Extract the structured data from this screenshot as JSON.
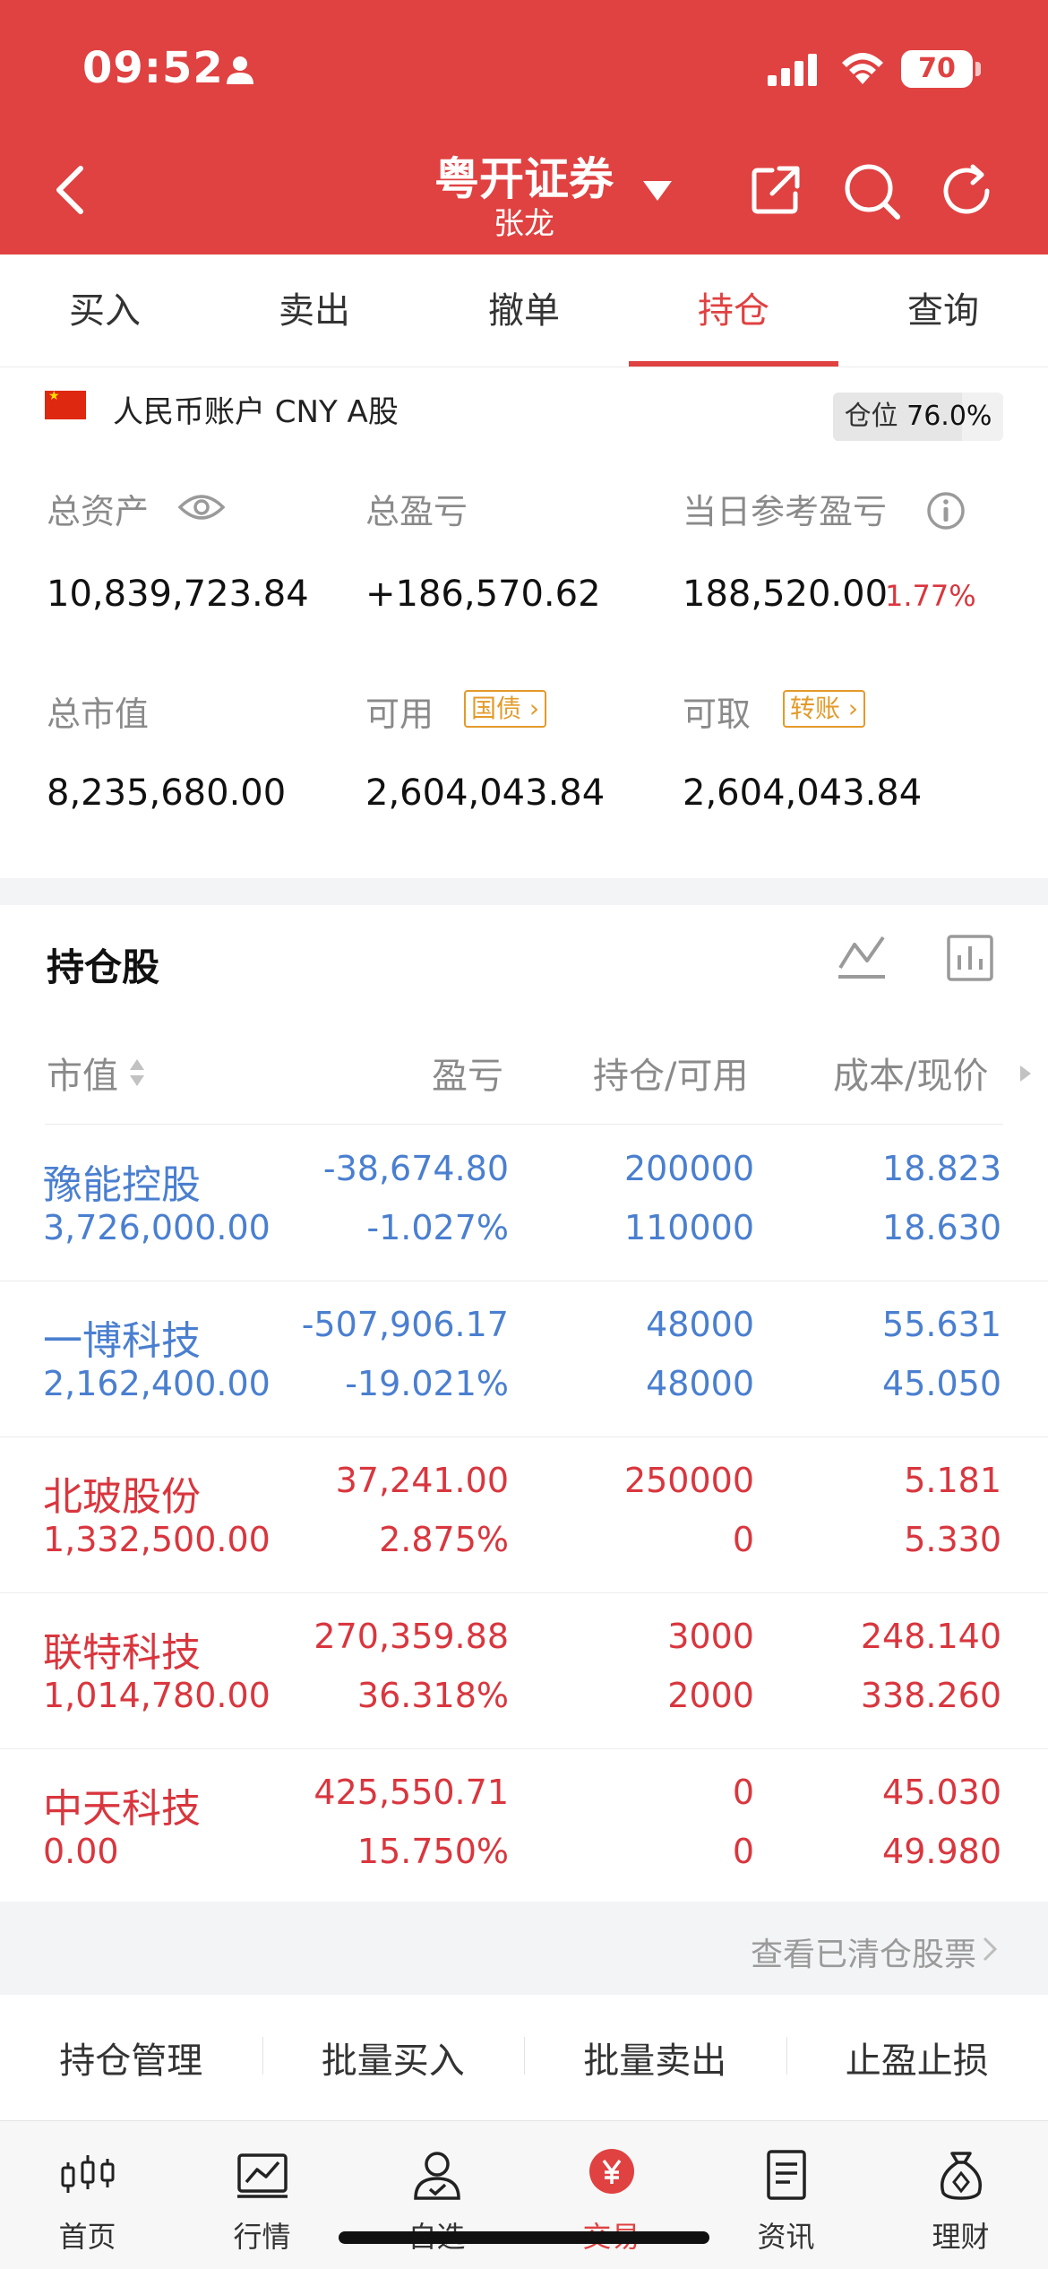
{
  "status_bar": {
    "time": "09:52",
    "battery": "70"
  },
  "header": {
    "title": "粤开证券",
    "user": "张龙"
  },
  "tabs": [
    {
      "label": "买入",
      "active": false
    },
    {
      "label": "卖出",
      "active": false
    },
    {
      "label": "撤单",
      "active": false
    },
    {
      "label": "持仓",
      "active": true
    },
    {
      "label": "查询",
      "active": false
    }
  ],
  "account": {
    "label": "人民币账户 CNY A股",
    "position_label": "仓位",
    "position_value": "76.0%",
    "position_fraction": 0.76,
    "total_assets_label": "总资产",
    "total_assets": "10,839,723.84",
    "total_pnl_label": "总盈亏",
    "total_pnl": "+186,570.62",
    "daily_pnl_label": "当日参考盈亏",
    "daily_pnl": "188,520.00",
    "daily_pnl_pct": "1.77%",
    "market_value_label": "总市值",
    "market_value": "8,235,680.00",
    "available_label": "可用",
    "available_tag": "国债",
    "available": "2,604,043.84",
    "withdrawable_label": "可取",
    "withdrawable_tag": "转账",
    "withdrawable": "2,604,043.84"
  },
  "holdings": {
    "title": "持仓股",
    "columns": {
      "market_value": "市值",
      "pnl": "盈亏",
      "position": "持仓/可用",
      "cost": "成本/现价"
    },
    "rows": [
      {
        "name": "豫能控股",
        "market_value": "3,726,000.00",
        "pnl": "-38,674.80",
        "pnl_pct": "-1.027%",
        "position": "200000",
        "available": "110000",
        "cost": "18.823",
        "price": "18.630",
        "color": "blue"
      },
      {
        "name": "一博科技",
        "market_value": "2,162,400.00",
        "pnl": "-507,906.17",
        "pnl_pct": "-19.021%",
        "position": "48000",
        "available": "48000",
        "cost": "55.631",
        "price": "45.050",
        "color": "blue"
      },
      {
        "name": "北玻股份",
        "market_value": "1,332,500.00",
        "pnl": "37,241.00",
        "pnl_pct": "2.875%",
        "position": "250000",
        "available": "0",
        "cost": "5.181",
        "price": "5.330",
        "color": "red"
      },
      {
        "name": "联特科技",
        "market_value": "1,014,780.00",
        "pnl": "270,359.88",
        "pnl_pct": "36.318%",
        "position": "3000",
        "available": "2000",
        "cost": "248.140",
        "price": "338.260",
        "color": "red"
      },
      {
        "name": "中天科技",
        "market_value": "0.00",
        "pnl": "425,550.71",
        "pnl_pct": "15.750%",
        "position": "0",
        "available": "0",
        "cost": "45.030",
        "price": "49.980",
        "color": "red"
      }
    ],
    "cleared_link": "查看已清仓股票"
  },
  "actions": [
    "持仓管理",
    "批量买入",
    "批量卖出",
    "止盈止损"
  ],
  "nav": [
    {
      "label": "首页",
      "icon": "candlestick-icon"
    },
    {
      "label": "行情",
      "icon": "chart-line-icon"
    },
    {
      "label": "自选",
      "icon": "user-check-icon"
    },
    {
      "label": "交易",
      "icon": "yuan-icon",
      "active": true
    },
    {
      "label": "资讯",
      "icon": "document-icon"
    },
    {
      "label": "理财",
      "icon": "money-bag-icon"
    }
  ],
  "colors": {
    "brand_red": "#e04141",
    "loss_blue": "#4a7fd0",
    "gain_red": "#d9363e",
    "tag_orange": "#e39a2a"
  }
}
